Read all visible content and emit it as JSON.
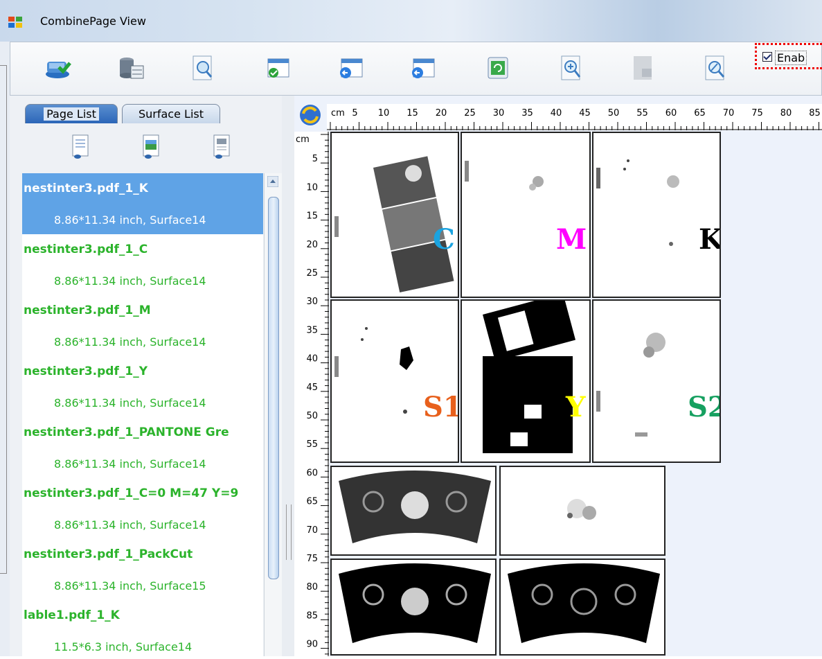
{
  "window": {
    "title": "CombinePage View"
  },
  "toolbar": {
    "buttons": [
      "send-icon",
      "database-icon",
      "preview-icon",
      "window-check-icon",
      "window-left-icon",
      "window-left-icon",
      "refresh-window-icon",
      "zoom-in-icon",
      "document-disabled-icon",
      "edit-zoom-icon"
    ],
    "enable_checked": true,
    "enable_label": "Enab"
  },
  "tabs": {
    "page_list": "Page List",
    "surface_list": "Surface List"
  },
  "list_icons": [
    "document-list-icon",
    "document-image-icon",
    "document-copy-icon"
  ],
  "pages": [
    {
      "name": "nestinter3.pdf_1_K",
      "info": "8.86*11.34 inch, Surface14",
      "selected": true
    },
    {
      "name": "nestinter3.pdf_1_C",
      "info": "8.86*11.34 inch, Surface14",
      "selected": false
    },
    {
      "name": "nestinter3.pdf_1_M",
      "info": "8.86*11.34 inch, Surface14",
      "selected": false
    },
    {
      "name": "nestinter3.pdf_1_Y",
      "info": "8.86*11.34 inch, Surface14",
      "selected": false
    },
    {
      "name": "nestinter3.pdf_1_PANTONE Gre",
      "info": "8.86*11.34 inch, Surface14",
      "selected": false
    },
    {
      "name": "nestinter3.pdf_1_C=0 M=47 Y=9",
      "info": "8.86*11.34 inch, Surface14",
      "selected": false
    },
    {
      "name": "nestinter3.pdf_1_PackCut",
      "info": "8.86*11.34 inch, Surface15",
      "selected": false
    },
    {
      "name": "lable1.pdf_1_K",
      "info": "11.5*6.3 inch, Surface14",
      "selected": false
    }
  ],
  "ruler": {
    "unit": "cm",
    "h_ticks": [
      "5",
      "10",
      "15",
      "20",
      "25",
      "30",
      "35",
      "40",
      "45",
      "50",
      "55",
      "60",
      "65",
      "70",
      "75",
      "80",
      "85"
    ],
    "v_ticks": [
      "5",
      "10",
      "15",
      "20",
      "25",
      "30",
      "35",
      "40",
      "45",
      "50",
      "55",
      "60",
      "65",
      "70",
      "75",
      "80",
      "85",
      "90"
    ]
  },
  "separations": [
    {
      "label": "C",
      "color": "#1aa3e0"
    },
    {
      "label": "M",
      "color": "#ff00ff"
    },
    {
      "label": "K",
      "color": "#000000"
    },
    {
      "label": "S1",
      "color": "#e8601c"
    },
    {
      "label": "Y",
      "color": "#ffff00"
    },
    {
      "label": "S2",
      "color": "#16a060"
    }
  ]
}
